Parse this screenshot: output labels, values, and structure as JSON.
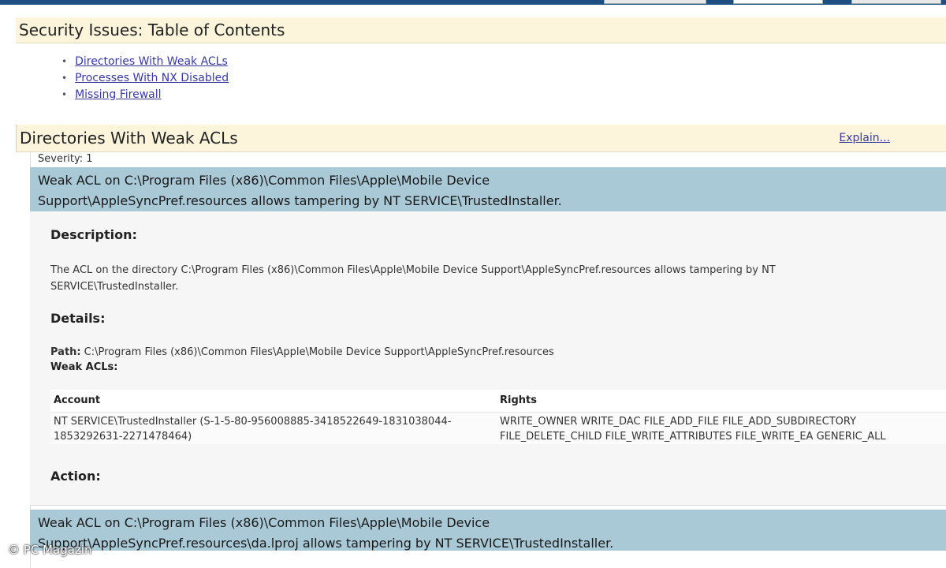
{
  "toc": {
    "title": "Security Issues: Table of Contents",
    "items": [
      {
        "label": "Directories With Weak ACLs"
      },
      {
        "label": "Processes With NX Disabled"
      },
      {
        "label": "Missing Firewall"
      }
    ]
  },
  "section": {
    "title": "Directories With Weak ACLs",
    "explain_link": "Explain...",
    "severity": "Severity: 1"
  },
  "issue1": {
    "title_line1": "Weak ACL on C:\\Program Files (x86)\\Common Files\\Apple\\Mobile Device",
    "title_line2": "Support\\AppleSyncPref.resources allows tampering by NT SERVICE\\TrustedInstaller.",
    "description_label": "Description:",
    "description_text": "The ACL on the directory C:\\Program Files (x86)\\Common Files\\Apple\\Mobile Device Support\\AppleSyncPref.resources allows tampering by NT SERVICE\\TrustedInstaller.",
    "details_label": "Details:",
    "path_label": "Path:",
    "path_value": "C:\\Program Files (x86)\\Common Files\\Apple\\Mobile Device Support\\AppleSyncPref.resources",
    "weak_acls_label": "Weak ACLs:",
    "table": {
      "headers": {
        "account": "Account",
        "rights": "Rights"
      },
      "row": {
        "account": "NT SERVICE\\TrustedInstaller (S-1-5-80-956008885-3418522649-1831038044-1853292631-2271478464)",
        "rights_line1": "WRITE_OWNER WRITE_DAC FILE_ADD_FILE FILE_ADD_SUBDIRECTORY",
        "rights_line2": "FILE_DELETE_CHILD FILE_WRITE_ATTRIBUTES FILE_WRITE_EA GENERIC_ALL"
      }
    },
    "action_label": "Action:"
  },
  "issue2": {
    "title_line1": "Weak ACL on C:\\Program Files (x86)\\Common Files\\Apple\\Mobile Device",
    "title_line2": "Support\\AppleSyncPref.resources\\da.lproj allows tampering by NT SERVICE\\TrustedInstaller."
  },
  "watermark": "© PC Magazin",
  "colors": {
    "header_bg": "#fdf4dc",
    "issue_band": "#a9c9d6",
    "link": "#3a3a9a",
    "topbar": "#1f4e82"
  }
}
